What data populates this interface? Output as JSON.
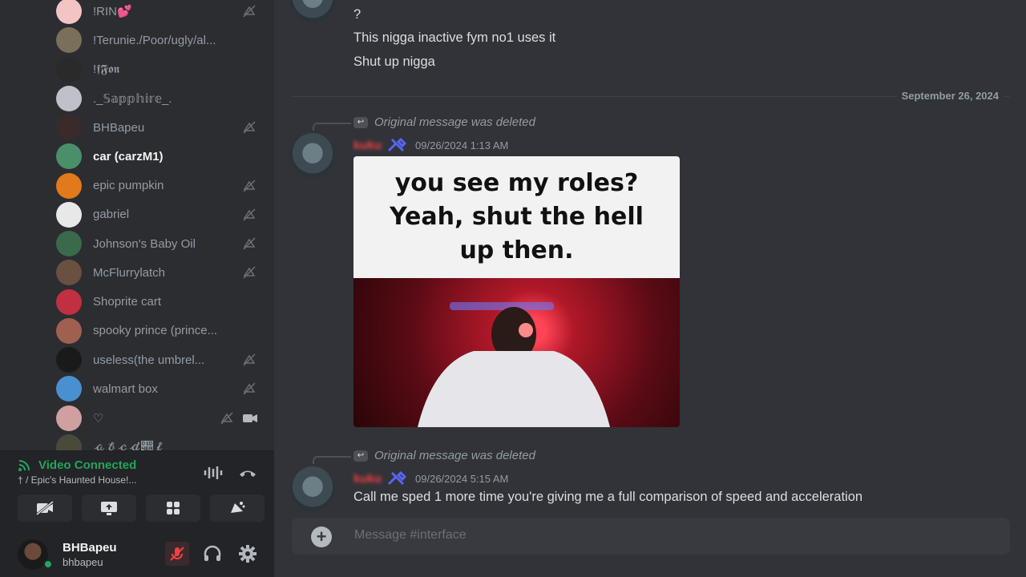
{
  "members": [
    {
      "name": "!RIN💕",
      "muted": true,
      "color": "#f3c4c4"
    },
    {
      "name": "!Terunie./Poor/ugly/al...",
      "muted": false,
      "color": "#7a6f5a"
    },
    {
      "name": "!𝖋𝕱𝖔𝖓",
      "muted": false,
      "color": "#2a2a2a"
    },
    {
      "name": "._𝕊𝕒𝕡𝕡𝕙𝕚𝕣𝕖_.",
      "muted": false,
      "color": "#c0c0c8"
    },
    {
      "name": "BHBapeu",
      "muted": true,
      "color": "#3a2a2a"
    },
    {
      "name": "car (carzM1)",
      "muted": false,
      "active": true,
      "color": "#4a8f6a"
    },
    {
      "name": "epic pumpkin",
      "muted": true,
      "color": "#e07a1a"
    },
    {
      "name": "gabriel",
      "muted": true,
      "color": "#e8e8e8"
    },
    {
      "name": "Johnson's Baby Oil",
      "muted": true,
      "color": "#3a6a4a"
    },
    {
      "name": "McFlurrylatch",
      "muted": true,
      "color": "#6a5040"
    },
    {
      "name": "Shoprite cart",
      "muted": false,
      "color": "#c03040"
    },
    {
      "name": "spooky prince (prince...",
      "muted": false,
      "color": "#a06050"
    },
    {
      "name": "useless(the umbrel...",
      "muted": true,
      "color": "#1a1a1a"
    },
    {
      "name": "walmart box",
      "muted": true,
      "color": "#4a8fd0"
    },
    {
      "name": "♡",
      "muted": true,
      "video": true,
      "color": "#d0a0a0"
    },
    {
      "name": "𝒶𝒷𝒸𝒹𝒺𝒻",
      "muted": false,
      "color": "#4a4a3a"
    }
  ],
  "voice": {
    "status": "Video Connected",
    "channel": "† / Epic's Haunted House!..."
  },
  "user": {
    "display_name": "BHBapeu",
    "username": "bhbapeu"
  },
  "messages": {
    "m1_line1": "?",
    "m1_line2": "This nigga inactive fym no1 uses it",
    "m1_line3": "Shut up nigga",
    "date_divider": "September 26, 2024",
    "reply1": "Original message was deleted",
    "author1": "kuku",
    "ts1": "09/26/2024 1:13 AM",
    "meme_line1": "you see my roles?",
    "meme_line2": "Yeah, shut the hell",
    "meme_line3": "up then.",
    "reply2": "Original message was deleted",
    "author2": "kuku",
    "ts2": "09/26/2024 5:15 AM",
    "text2": "Call me sped 1 more time you're giving me a full comparison of speed and acceleration"
  },
  "composer": {
    "placeholder": "Message #interface"
  },
  "colors": {
    "accent_green": "#23a55a",
    "author_red": "#f23f43",
    "role_icon_blue": "#5865f2"
  }
}
